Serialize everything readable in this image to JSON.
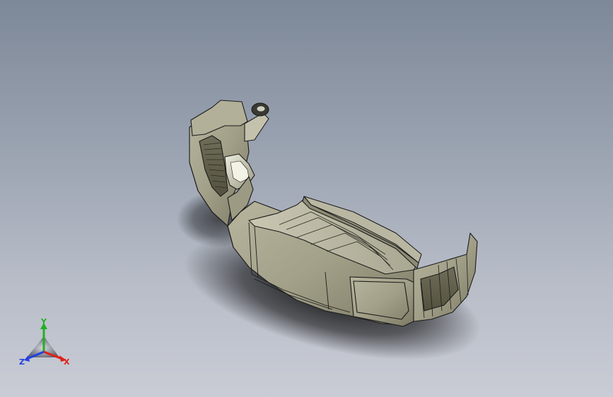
{
  "viewport": {
    "view": "Isometric",
    "background_top": "#7d8898",
    "background_bottom": "#c9ccd5"
  },
  "model": {
    "name": "front-bumper",
    "face_color": "#a6a48c",
    "edge_color": "#1c1c1c",
    "shadow": true
  },
  "triad": {
    "x_label": "X",
    "y_label": "Y",
    "z_label": "Z",
    "x_color": "#e0201a",
    "y_color": "#22b022",
    "z_color": "#2440e0"
  }
}
